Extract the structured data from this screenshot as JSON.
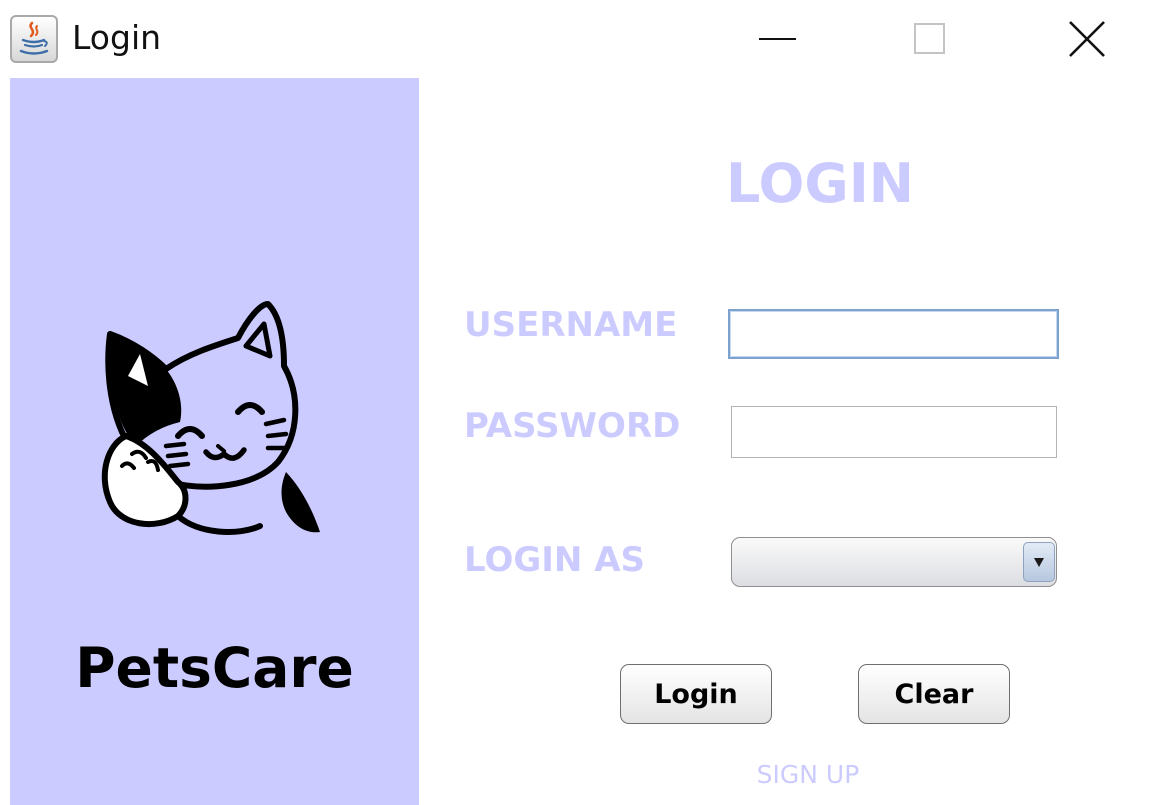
{
  "window": {
    "title": "Login",
    "icon": "java-icon",
    "controls": [
      "minimize-icon",
      "maximize-icon",
      "close-icon"
    ]
  },
  "brand": {
    "logo_icon": "cat-icon",
    "name": "PetsCare",
    "panel_color": "#cccbff"
  },
  "form": {
    "heading": "LOGIN",
    "accent_color": "#cccbff",
    "username": {
      "label": "USERNAME",
      "value": ""
    },
    "password": {
      "label": "PASSWORD",
      "value": ""
    },
    "login_as": {
      "label": "LOGIN AS",
      "selected": ""
    },
    "login_button": "Login",
    "clear_button": "Clear",
    "signup_link": "SIGN UP"
  }
}
